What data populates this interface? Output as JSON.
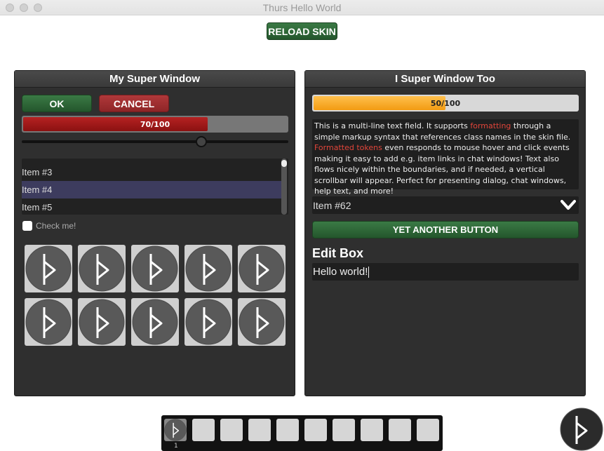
{
  "window": {
    "title": "Thurs Hello World"
  },
  "toolbar": {
    "reload_label": "RELOAD SKIN"
  },
  "panel_left": {
    "title": "My Super Window",
    "ok_label": "OK",
    "cancel_label": "CANCEL",
    "progress": {
      "text": "70/100",
      "value": 0.7
    },
    "slider": {
      "value": 0.68
    },
    "list_items": [
      {
        "label": "Item #3",
        "selected": false
      },
      {
        "label": "Item #4",
        "selected": true
      },
      {
        "label": "Item #5",
        "selected": false
      }
    ],
    "checkbox_label": "Check me!",
    "grid_icon": "rune-icon"
  },
  "panel_right": {
    "title": "I Super Window Too",
    "progress": {
      "text": "50/100",
      "value": 0.5
    },
    "text_field": {
      "p1": "This is a multi-line text field. It supports ",
      "link1": "formatting",
      "p2": " through a simple markup syntax that references class names in the skin file. ",
      "link2": "Formatted tokens",
      "p3": " even responds to mouse hover and click events making it easy to add e.g. item links in chat windows! Text also flows nicely within the boundaries, and if needed, a vertical scrollbar will appear. Perfect for presenting dialog, chat windows, help text, and more!"
    },
    "dropdown_value": "Item #62",
    "button_label": "YET ANOTHER BUTTON",
    "edit_label": "Edit Box",
    "edit_value": "Hello world!"
  },
  "hotbar": {
    "first_slot_count": "1"
  },
  "colors": {
    "accent_green": "#2f6b39",
    "accent_red": "#a53033",
    "progress_red": "#a51a1a",
    "progress_orange": "#f5a623",
    "highlight_text": "#e2453a"
  }
}
